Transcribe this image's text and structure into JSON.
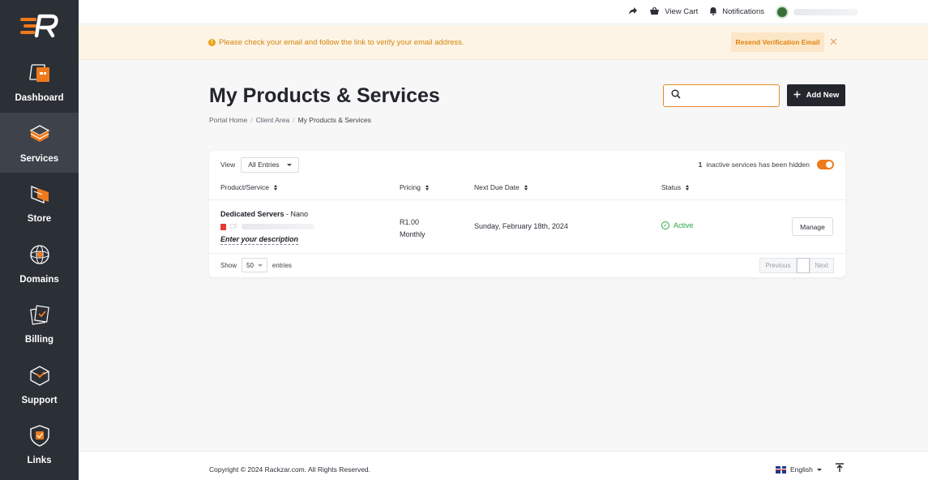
{
  "brand": {
    "accent": "#ee7a1c",
    "sidebar_bg": "#2b2f36",
    "active_bg": "#3e434b",
    "success": "#27a744"
  },
  "topbar": {
    "view_cart": "View Cart",
    "notifications": "Notifications"
  },
  "alert": {
    "message": "Please check your email and follow the link to verify your email address.",
    "resend_label": "Resend Verification Email",
    "close_glyph": "✕"
  },
  "sidebar": {
    "items": [
      {
        "label": "Dashboard",
        "icon": "dashboard-icon"
      },
      {
        "label": "Services",
        "icon": "services-icon",
        "active": true
      },
      {
        "label": "Store",
        "icon": "store-icon"
      },
      {
        "label": "Domains",
        "icon": "domains-icon"
      },
      {
        "label": "Billing",
        "icon": "billing-icon"
      },
      {
        "label": "Support",
        "icon": "support-icon"
      },
      {
        "label": "Links",
        "icon": "links-icon"
      }
    ]
  },
  "page": {
    "title": "My Products & Services",
    "breadcrumb": [
      "Portal Home",
      "Client Area",
      "My Products & Services"
    ],
    "breadcrumb_sep": "/",
    "add_new_label": "Add New"
  },
  "table": {
    "view_label": "View",
    "view_filter": "All Entries",
    "hidden_count": "1",
    "hidden_note": "inactive services has been hidden",
    "columns": [
      "Product/Service",
      "Pricing",
      "Next Due Date",
      "Status"
    ],
    "rows": [
      {
        "product_group": "Dedicated Servers",
        "product_name": " - Nano",
        "ip_prefix": "CF",
        "description": "Enter your description",
        "price": "R1.00",
        "cycle": "Monthly",
        "next_due": "Sunday, February 18th, 2024",
        "status": "Active",
        "action": "Manage"
      }
    ],
    "show_label": "Show",
    "page_size": "50",
    "entries_label": "entries",
    "prev_label": "Previous",
    "next_label": "Next"
  },
  "footer": {
    "copyright": "Copyright © 2024 Rackzar.com. All Rights Reserved.",
    "language": "English"
  }
}
